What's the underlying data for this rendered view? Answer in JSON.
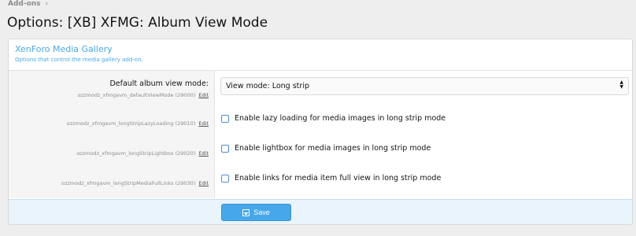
{
  "breadcrumb": {
    "item": "Add-ons",
    "separator": "›"
  },
  "page": {
    "title": "Options: [XB] XFMG: Album View Mode"
  },
  "block": {
    "title": "XenForo Media Gallery",
    "description": "Options that control the media gallery add-on."
  },
  "options": [
    {
      "label": "Default album view mode:",
      "hint": "ozzmodz_xfmgavm_defaultViewMode (29000)",
      "edit": "Edit",
      "select_value": "View mode: Long strip"
    },
    {
      "label": "",
      "hint": "ozzmodz_xfmgavm_longStripLazyLoading (29010)",
      "edit": "Edit",
      "checkbox_label": "Enable lazy loading for media images in long strip mode"
    },
    {
      "label": "",
      "hint": "ozzmodz_xfmgavm_longStripLightbox (29020)",
      "edit": "Edit",
      "checkbox_label": "Enable lightbox for media images in long strip mode"
    },
    {
      "label": "",
      "hint": "ozzmodz_xfmgavm_longStripMediaFullLinks (29030)",
      "edit": "Edit",
      "checkbox_label": "Enable links for media item full view in long strip mode"
    }
  ],
  "footer": {
    "save_label": "Save"
  },
  "colors": {
    "accent": "#47a7eb",
    "footer_bg": "#e9f4fc",
    "page_bg": "#eeeeee"
  }
}
